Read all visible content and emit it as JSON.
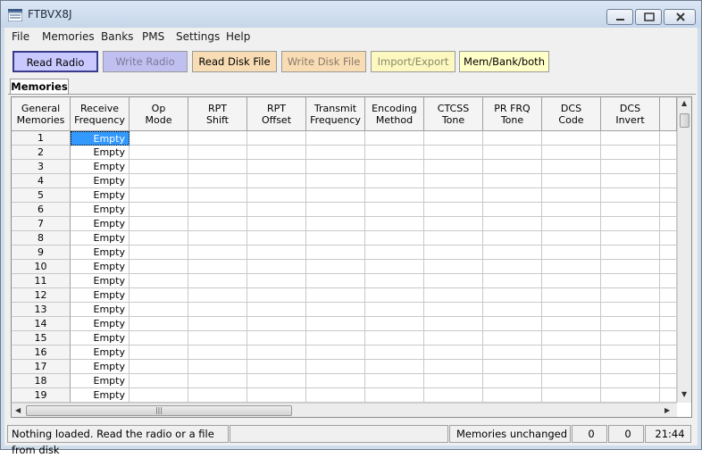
{
  "window": {
    "title": "FTBVX8J"
  },
  "menu": [
    "File",
    "Memories",
    "Banks",
    "PMS",
    "Settings",
    "Help"
  ],
  "toolbar": {
    "read_radio": "Read Radio",
    "write_radio": "Write Radio",
    "read_disk": "Read Disk File",
    "write_disk": "Write Disk File",
    "import_export": "Import/Export",
    "mem_bank": "Mem/Bank/both"
  },
  "tabs": {
    "memories": "Memories"
  },
  "grid": {
    "headers": [
      "General\nMemories",
      "Receive\nFrequency",
      "Op\nMode",
      "RPT\nShift",
      "RPT\nOffset",
      "Transmit\nFrequency",
      "Encoding\nMethod",
      "CTCSS\nTone",
      "PR FRQ\nTone",
      "DCS\nCode",
      "DCS\nInvert"
    ],
    "rows": [
      {
        "num": "1",
        "rx": "Empty"
      },
      {
        "num": "2",
        "rx": "Empty"
      },
      {
        "num": "3",
        "rx": "Empty"
      },
      {
        "num": "4",
        "rx": "Empty"
      },
      {
        "num": "5",
        "rx": "Empty"
      },
      {
        "num": "6",
        "rx": "Empty"
      },
      {
        "num": "7",
        "rx": "Empty"
      },
      {
        "num": "8",
        "rx": "Empty"
      },
      {
        "num": "9",
        "rx": "Empty"
      },
      {
        "num": "10",
        "rx": "Empty"
      },
      {
        "num": "11",
        "rx": "Empty"
      },
      {
        "num": "12",
        "rx": "Empty"
      },
      {
        "num": "13",
        "rx": "Empty"
      },
      {
        "num": "14",
        "rx": "Empty"
      },
      {
        "num": "15",
        "rx": "Empty"
      },
      {
        "num": "16",
        "rx": "Empty"
      },
      {
        "num": "17",
        "rx": "Empty"
      },
      {
        "num": "18",
        "rx": "Empty"
      },
      {
        "num": "19",
        "rx": "Empty"
      }
    ],
    "selected_row": 0
  },
  "status": {
    "message": "Nothing loaded. Read the radio or a file from disk",
    "blank": "",
    "memories_state": "Memories unchanged",
    "count_a": "0",
    "count_b": "0",
    "time": "21:44"
  },
  "colors": {
    "read_radio_bg": "#c9c9ff",
    "write_radio_bg": "#c0c0f0",
    "read_disk_bg": "#f8dcb4",
    "write_disk_bg": "#f8dcb4",
    "import_bg": "#fdf8c0",
    "membank_bg": "#ffffc8",
    "selection": "#3399ff"
  }
}
